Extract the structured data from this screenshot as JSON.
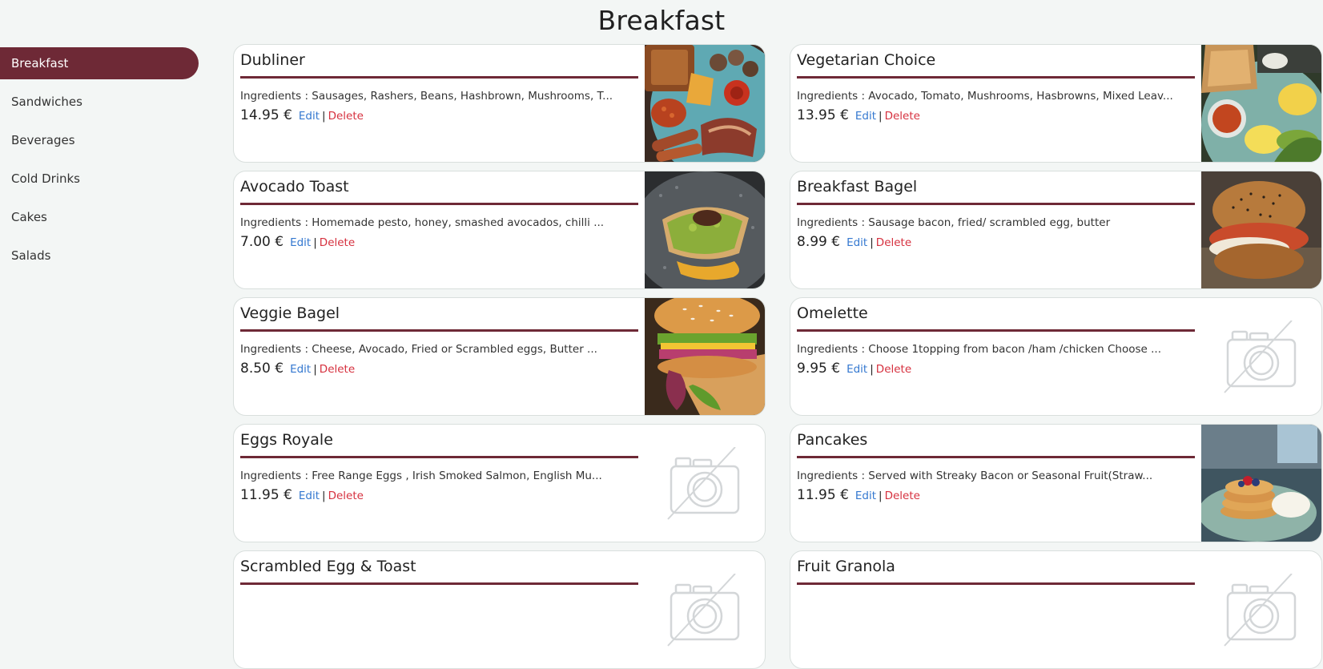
{
  "page": {
    "title": "Breakfast"
  },
  "sidebar": {
    "items": [
      {
        "label": "Breakfast",
        "active": true
      },
      {
        "label": "Sandwiches"
      },
      {
        "label": "Beverages"
      },
      {
        "label": "Cold Drinks"
      },
      {
        "label": "Cakes"
      },
      {
        "label": "Salads"
      }
    ]
  },
  "actions": {
    "edit": "Edit",
    "separator": "|",
    "delete": "Delete"
  },
  "items": [
    {
      "name": "Dubliner",
      "ingredients": "Ingredients : Sausages, Rashers, Beans, Hashbrown, Mushrooms, T...",
      "price": "14.95 €",
      "image": "full-irish-breakfast-photo"
    },
    {
      "name": "Vegetarian Choice",
      "ingredients": "Ingredients : Avocado, Tomato, Mushrooms, Hasbrowns, Mixed Leav...",
      "price": "13.95 €",
      "image": "vegetarian-breakfast-photo"
    },
    {
      "name": "Avocado Toast",
      "ingredients": "Ingredients : Homemade pesto, honey, smashed avocados, chilli ...",
      "price": "7.00 €",
      "image": "avocado-toast-photo"
    },
    {
      "name": "Breakfast Bagel",
      "ingredients": "Ingredients : Sausage bacon, fried/ scrambled egg, butter",
      "price": "8.99 €",
      "image": "breakfast-bagel-photo"
    },
    {
      "name": "Veggie Bagel",
      "ingredients": "Ingredients : Cheese, Avocado, Fried or Scrambled eggs, Butter ...",
      "price": "8.50 €",
      "image": "veggie-bagel-photo"
    },
    {
      "name": "Omelette",
      "ingredients": "Ingredients : Choose 1topping from bacon /ham /chicken Choose ...",
      "price": "9.95 €",
      "image": "no-image-icon"
    },
    {
      "name": "Eggs Royale",
      "ingredients": "Ingredients : Free Range Eggs , Irish Smoked Salmon, English Mu...",
      "price": "11.95 €",
      "image": "no-image-icon"
    },
    {
      "name": "Pancakes",
      "ingredients": "Ingredients : Served with Streaky Bacon or Seasonal Fruit(Straw...",
      "price": "11.95 €",
      "image": "pancakes-photo"
    },
    {
      "name": "Scrambled Egg & Toast",
      "ingredients": "",
      "price": "",
      "image": "no-image-icon"
    },
    {
      "name": "Fruit Granola",
      "ingredients": "",
      "price": "",
      "image": "no-image-icon"
    }
  ],
  "colors": {
    "accent": "#6e2936",
    "edit_link": "#3478d0",
    "delete_link": "#d6313f",
    "background": "#f3f6f5"
  }
}
